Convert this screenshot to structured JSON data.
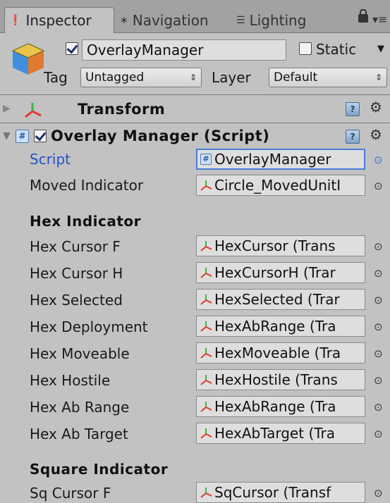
{
  "tabs": [
    {
      "label": "Inspector",
      "icon": "info-icon"
    },
    {
      "label": "Navigation",
      "icon": "asterisk-icon"
    },
    {
      "label": "Lighting",
      "icon": "lighting-icon"
    }
  ],
  "object": {
    "name": "OverlayManager",
    "active": true,
    "static_label": "Static",
    "static": false,
    "tag_label": "Tag",
    "tag_value": "Untagged",
    "layer_label": "Layer",
    "layer_value": "Default"
  },
  "components": {
    "transform": {
      "title": "Transform",
      "expanded": false
    },
    "script": {
      "title": "Overlay Manager (Script)",
      "expanded": true,
      "enabled": true
    }
  },
  "properties": {
    "script": {
      "label": "Script",
      "value": "OverlayManager"
    },
    "moved_indicator": {
      "label": "Moved Indicator",
      "value": "Circle_MovedUnitI"
    }
  },
  "hex_section": {
    "title": "Hex Indicator",
    "rows": [
      {
        "label": "Hex Cursor F",
        "value": "HexCursor (Trans"
      },
      {
        "label": "Hex Cursor H",
        "value": "HexCursorH (Trar"
      },
      {
        "label": "Hex Selected",
        "value": "HexSelected (Trar"
      },
      {
        "label": "Hex Deployment",
        "value": "HexAbRange (Tra"
      },
      {
        "label": "Hex Moveable",
        "value": "HexMoveable (Tra"
      },
      {
        "label": "Hex Hostile",
        "value": "HexHostile (Trans"
      },
      {
        "label": "Hex Ab Range",
        "value": "HexAbRange (Tra"
      },
      {
        "label": "Hex Ab Target",
        "value": "HexAbTarget (Tra"
      }
    ]
  },
  "square_section": {
    "title": "Square Indicator",
    "rows": [
      {
        "label": "Sq Cursor F",
        "value": "SqCursor (Transf"
      }
    ]
  },
  "colors": {
    "panel_bg": "#c2c2c2",
    "script_label": "#2454c4",
    "focus_border": "#4a7ed8"
  }
}
